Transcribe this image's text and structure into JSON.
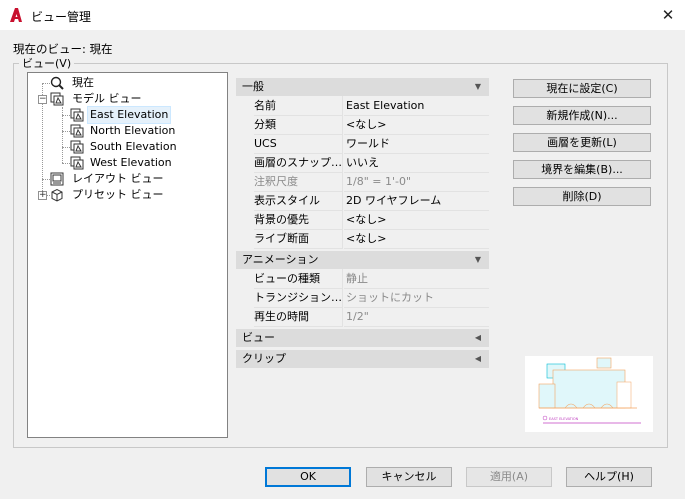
{
  "window": {
    "title": "ビュー管理",
    "close_glyph": "✕"
  },
  "current_view": {
    "label": "現在のビュー: 現在"
  },
  "views_group": {
    "legend": "ビュー(V)"
  },
  "tree": {
    "current": "現在",
    "model_views": "モデル ビュー",
    "items": [
      "East Elevation",
      "North Elevation",
      "South Elevation",
      "West Elevation"
    ],
    "layout_views": "レイアウト ビュー",
    "preset_views": "プリセット ビュー",
    "selected": "East Elevation"
  },
  "properties": {
    "general": {
      "title": "一般",
      "rows": [
        {
          "k": "名前",
          "v": "East Elevation",
          "dim": false
        },
        {
          "k": "分類",
          "v": "<なし>",
          "dim": false
        },
        {
          "k": "UCS",
          "v": "ワールド",
          "dim": false
        },
        {
          "k": "画層のスナップ…",
          "v": "いいえ",
          "dim": false
        },
        {
          "k": "注釈尺度",
          "v": "1/8\" = 1'-0\"",
          "dim": true
        },
        {
          "k": "表示スタイル",
          "v": "2D ワイヤフレーム",
          "dim": false
        },
        {
          "k": "背景の優先",
          "v": "<なし>",
          "dim": false
        },
        {
          "k": "ライブ断面",
          "v": "<なし>",
          "dim": false
        }
      ]
    },
    "animation": {
      "title": "アニメーション",
      "rows": [
        {
          "k": "ビューの種類",
          "v": "静止",
          "dim": true
        },
        {
          "k": "トランジション…",
          "v": "ショットにカット",
          "dim": true
        },
        {
          "k": "再生の時間",
          "v": "1/2\"",
          "dim": true
        }
      ]
    },
    "view_section": {
      "title": "ビュー"
    },
    "clip_section": {
      "title": "クリップ"
    }
  },
  "side_buttons": {
    "set_current": "現在に設定(C)",
    "new": "新規作成(N)...",
    "update_layers": "画層を更新(L)",
    "edit_boundaries": "境界を編集(B)...",
    "delete": "削除(D)"
  },
  "preview": {
    "caption": "EAST ELEVATION"
  },
  "footer_buttons": {
    "ok": "OK",
    "cancel": "キャンセル",
    "apply": "適用(A)",
    "help": "ヘルプ(H)"
  },
  "colors": {
    "accent_blue": "#0078d7",
    "autocad_red": "#c8102e",
    "drawing_orange": "#f4a460",
    "drawing_cyan": "#00bcd4",
    "drawing_magenta": "#c040c0"
  }
}
